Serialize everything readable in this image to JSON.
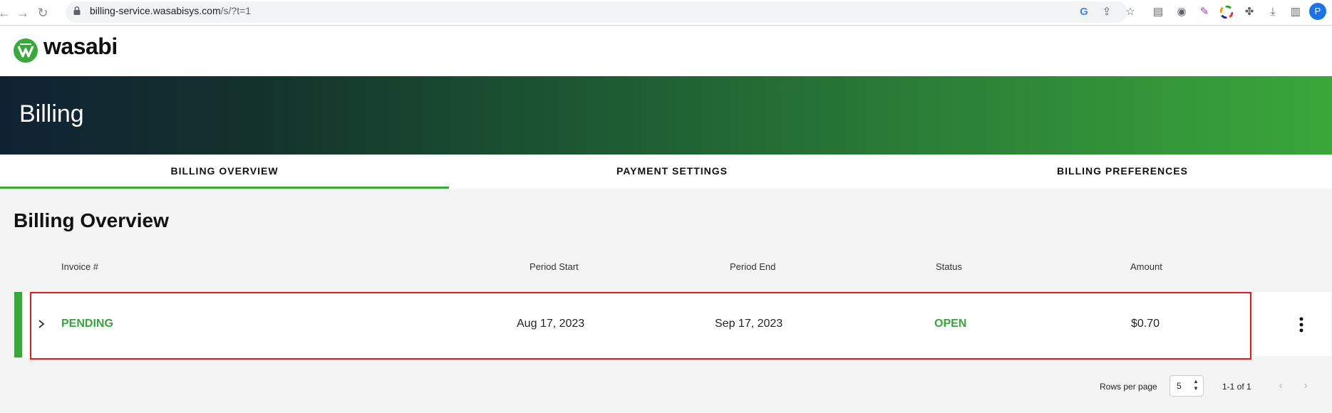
{
  "browser": {
    "url_host": "billing-service.wasabisys.com",
    "url_path": "/s/?t=1",
    "profile_initial": "P",
    "extensions": [
      "google-icon",
      "share-icon",
      "star-icon",
      "clipboard-icon",
      "camera-icon",
      "pen-icon",
      "color-wheel-icon",
      "puzzle-icon",
      "download-icon",
      "sidebar-icon"
    ]
  },
  "header": {
    "logo_text": "wasabi"
  },
  "banner": {
    "title": "Billing"
  },
  "tabs": [
    {
      "label": "BILLING OVERVIEW",
      "active": true
    },
    {
      "label": "PAYMENT SETTINGS",
      "active": false
    },
    {
      "label": "BILLING PREFERENCES",
      "active": false
    }
  ],
  "overview": {
    "title": "Billing Overview",
    "columns": [
      "Invoice #",
      "Period Start",
      "Period End",
      "Status",
      "Amount"
    ],
    "rows": [
      {
        "invoice": "PENDING",
        "period_start": "Aug 17, 2023",
        "period_end": "Sep 17, 2023",
        "status": "OPEN",
        "amount": "$0.70"
      }
    ]
  },
  "pagination": {
    "rows_per_page_label": "Rows per page",
    "rows_per_page": "5",
    "range": "1-1 of 1"
  },
  "colors": {
    "accent": "#3aa73a",
    "highlight": "#e21b1b"
  }
}
